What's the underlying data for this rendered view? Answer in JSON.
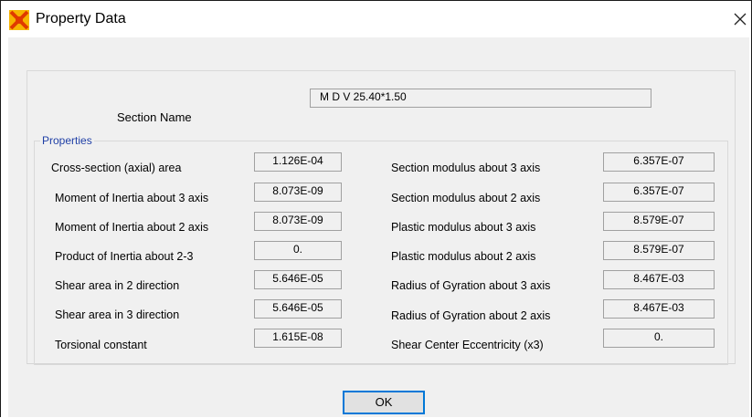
{
  "window": {
    "title": "Property Data",
    "close_glyph": "✕"
  },
  "section": {
    "label": "Section Name",
    "value": "M D V 25.40*1.50"
  },
  "properties": {
    "legend": "Properties",
    "left": [
      {
        "label": "Cross-section (axial) area",
        "value": "1.126E-04"
      },
      {
        "label": "Moment of Inertia about 3 axis",
        "value": "8.073E-09"
      },
      {
        "label": "Moment of Inertia about 2 axis",
        "value": "8.073E-09"
      },
      {
        "label": "Product of Inertia about 2-3",
        "value": "0."
      },
      {
        "label": "Shear area in 2 direction",
        "value": "5.646E-05"
      },
      {
        "label": "Shear area in 3 direction",
        "value": "5.646E-05"
      },
      {
        "label": "Torsional constant",
        "value": "1.615E-08"
      }
    ],
    "right": [
      {
        "label": "Section modulus about 3 axis",
        "value": "6.357E-07"
      },
      {
        "label": "Section modulus about 2 axis",
        "value": "6.357E-07"
      },
      {
        "label": "Plastic modulus about 3 axis",
        "value": "8.579E-07"
      },
      {
        "label": "Plastic modulus about 2 axis",
        "value": "8.579E-07"
      },
      {
        "label": "Radius of Gyration about 3 axis",
        "value": "8.467E-03"
      },
      {
        "label": "Radius of Gyration about 2 axis",
        "value": "8.467E-03"
      },
      {
        "label": "Shear Center Eccentricity (x3)",
        "value": "0."
      }
    ]
  },
  "buttons": {
    "ok_label": "OK"
  },
  "colors": {
    "legend_text": "#1f3fa6",
    "ok_border": "#0078d7",
    "dialog_bg": "#f0f0f0"
  },
  "icons": {
    "app": "sap-app-icon",
    "close": "close-icon"
  }
}
